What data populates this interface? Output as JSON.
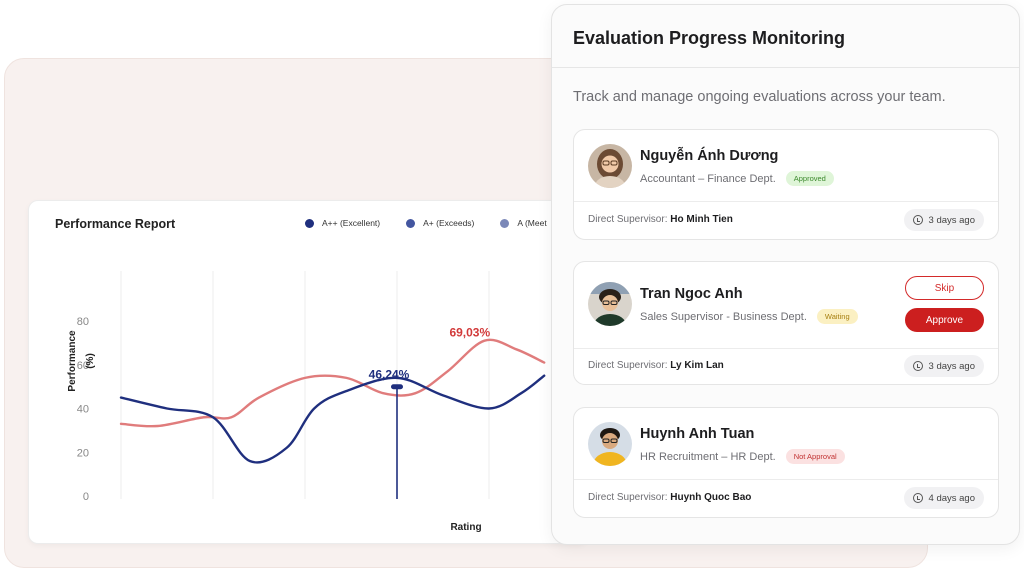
{
  "report": {
    "title": "Performance Report",
    "legend": [
      {
        "label": "A++ (Excellent)",
        "color": "#1f2f7e"
      },
      {
        "label": "A+ (Exceeds)",
        "color": "#4356a0"
      },
      {
        "label": "A (Meet",
        "color": "#7b88b8"
      }
    ]
  },
  "chart_data": {
    "type": "line",
    "xlabel": "Rating",
    "ylabel": "Performance (%)",
    "ylim": [
      0,
      80
    ],
    "yticks": [
      0,
      20,
      40,
      60,
      80
    ],
    "grid": "vertical",
    "series": [
      {
        "color": "#1f2f7e",
        "points": [
          [
            0,
            45
          ],
          [
            0.5,
            40
          ],
          [
            1.0,
            36
          ],
          [
            1.4,
            16
          ],
          [
            1.8,
            22
          ],
          [
            2.1,
            40
          ],
          [
            2.45,
            48
          ],
          [
            3.0,
            54
          ],
          [
            3.5,
            46
          ],
          [
            4.0,
            40
          ],
          [
            4.35,
            47
          ],
          [
            4.6,
            55
          ]
        ]
      },
      {
        "color": "#e07c7c",
        "points": [
          [
            0,
            33
          ],
          [
            0.4,
            32
          ],
          [
            0.9,
            36
          ],
          [
            1.2,
            36
          ],
          [
            1.5,
            45
          ],
          [
            2.0,
            54
          ],
          [
            2.45,
            54
          ],
          [
            2.85,
            47
          ],
          [
            3.2,
            47
          ],
          [
            3.55,
            57
          ],
          [
            3.95,
            71
          ],
          [
            4.3,
            67
          ],
          [
            4.6,
            61
          ]
        ]
      }
    ],
    "annotations": [
      {
        "label": "46,24%",
        "x": 3.0,
        "y": 52,
        "color": "#1f2f7e",
        "marker": true
      },
      {
        "label": "69,03%",
        "x": 3.9,
        "y": 73,
        "color": "#d23a3a",
        "marker": false
      }
    ]
  },
  "evaluation": {
    "title": "Evaluation Progress Monitoring",
    "subtitle": "Track and manage ongoing evaluations across your team.",
    "supervisor_label": "Direct Supervisor:",
    "employees": [
      {
        "name": "Nguyễn Ánh Dương",
        "role": "Accountant – Finance Dept.",
        "status": "Approved",
        "supervisor": "Ho Minh Tien",
        "time": "3 days ago"
      },
      {
        "name": "Tran Ngoc Anh",
        "role": "Sales Supervisor - Business Dept.",
        "status": "Waiting",
        "supervisor": "Ly Kim Lan",
        "time": "3 days ago",
        "actions": {
          "skip": "Skip",
          "approve": "Approve"
        }
      },
      {
        "name": "Huynh Anh Tuan",
        "role": "HR Recruitment – HR Dept.",
        "status": "Not Approval",
        "supervisor": "Huynh Quoc Bao",
        "time": "4 days ago"
      }
    ]
  }
}
